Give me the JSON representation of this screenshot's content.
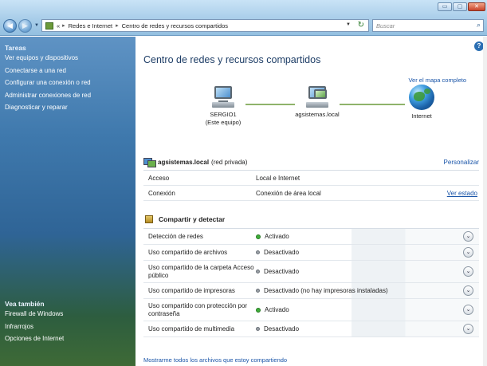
{
  "window": {
    "min_icon": "▭",
    "max_icon": "▢",
    "close_icon": "✕"
  },
  "nav": {
    "back_icon": "◀",
    "forward_icon": "▶",
    "dropdown_icon": "▼",
    "breadcrumb_prefix": "«",
    "breadcrumb": [
      "Redes e Internet",
      "Centro de redes y recursos compartidos"
    ],
    "breadcrumb_sep": "▸",
    "refresh_icon": "↻",
    "search_placeholder": "Buscar",
    "search_icon": "⌕"
  },
  "sidebar": {
    "tasks_title": "Tareas",
    "tasks": [
      "Ver equipos y dispositivos",
      "Conectarse a una red",
      "Configurar una conexión o red",
      "Administrar conexiones de red",
      "Diagnosticar y reparar"
    ],
    "see_also_title": "Vea también",
    "see_also": [
      "Firewall de Windows",
      "Infrarrojos",
      "Opciones de Internet"
    ]
  },
  "main": {
    "help_icon": "?",
    "title": "Centro de redes y recursos compartidos",
    "full_map_link": "Ver el mapa completo",
    "map": {
      "computer_name": "SERGIO1",
      "computer_sub": "(Este equipo)",
      "network_name": "agsistemas.local",
      "internet_label": "Internet"
    },
    "network": {
      "name": "agsistemas.local",
      "type": "(red privada)",
      "customize_link": "Personalizar",
      "rows": [
        {
          "key": "Acceso",
          "value": "Local e Internet",
          "action": ""
        },
        {
          "key": "Conexión",
          "value": "Conexión de área local",
          "action": "Ver estado"
        }
      ]
    },
    "sharing": {
      "title": "Compartir y detectar",
      "expand_icon": "⌄",
      "rows": [
        {
          "key": "Detección de redes",
          "value": "Activado",
          "state": "on"
        },
        {
          "key": "Uso compartido de archivos",
          "value": "Desactivado",
          "state": "off"
        },
        {
          "key": "Uso compartido de la carpeta Acceso público",
          "value": "Desactivado",
          "state": "off"
        },
        {
          "key": "Uso compartido de impresoras",
          "value": "Desactivado (no hay impresoras instaladas)",
          "state": "off"
        },
        {
          "key": "Uso compartido con protección por contraseña",
          "value": "Activado",
          "state": "on"
        },
        {
          "key": "Uso compartido de multimedia",
          "value": "Desactivado",
          "state": "off"
        }
      ]
    },
    "show_all_link": "Mostrarme todos los archivos que estoy compartiendo"
  }
}
